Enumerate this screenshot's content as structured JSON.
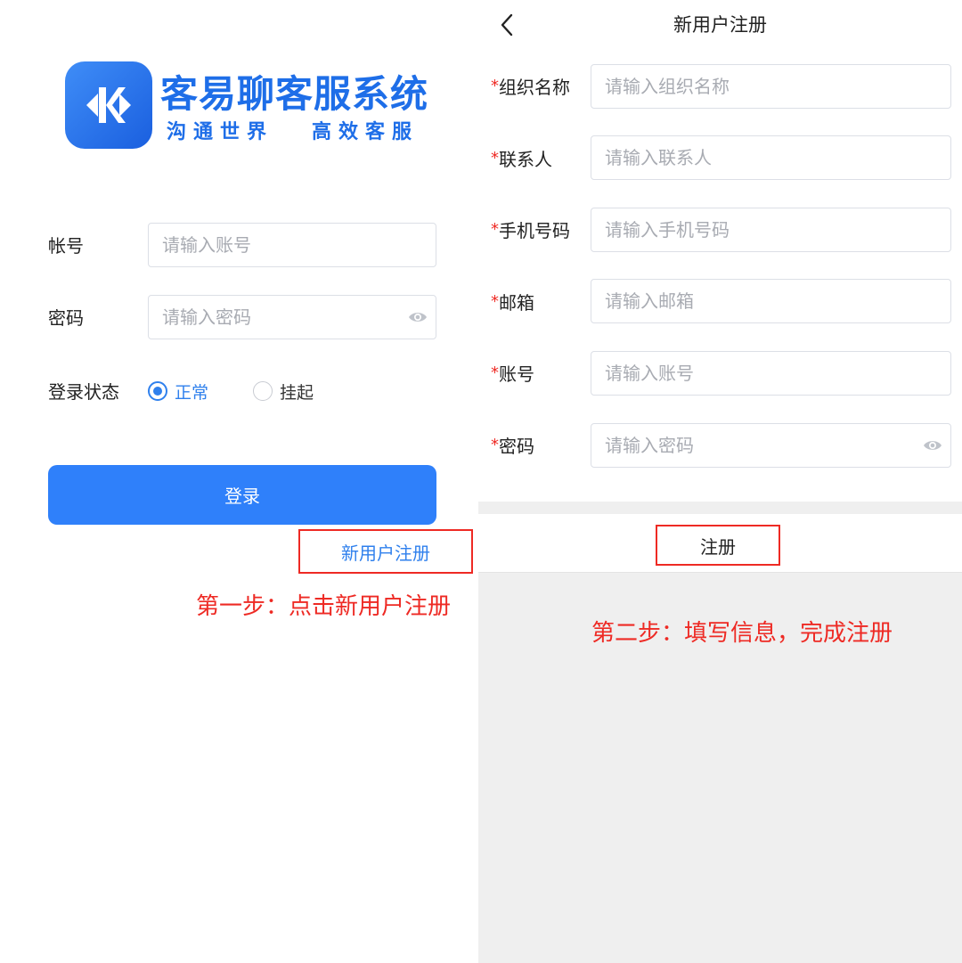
{
  "login": {
    "logo": {
      "title": "客易聊客服系统",
      "slogan_part1": "沟通世界",
      "slogan_part2": "高效客服",
      "brand_color": "#1e6ee8"
    },
    "account_label": "帐号",
    "account_placeholder": "请输入账号",
    "password_label": "密码",
    "password_placeholder": "请输入密码",
    "status_label": "登录状态",
    "status_options": [
      {
        "label": "正常",
        "checked": true
      },
      {
        "label": "挂起",
        "checked": false
      }
    ],
    "login_button": "登录",
    "register_link": "新用户注册",
    "annotation": "第一步：点击新用户注册",
    "accent_color": "#2f80fa",
    "annotation_color": "#ee2a24"
  },
  "register": {
    "title": "新用户注册",
    "back_icon": "chevron-left-icon",
    "fields": [
      {
        "star": "*",
        "label": "组织名称",
        "placeholder": "请输入组织名称"
      },
      {
        "star": "*",
        "label": "联系人",
        "placeholder": "请输入联系人"
      },
      {
        "star": "*",
        "label": "手机号码",
        "placeholder": "请输入手机号码"
      },
      {
        "star": "*",
        "label": "邮箱",
        "placeholder": "请输入邮箱"
      },
      {
        "star": "*",
        "label": "账号",
        "placeholder": "请输入账号"
      },
      {
        "star": "*",
        "label": "密码",
        "placeholder": "请输入密码"
      }
    ],
    "submit_button": "注册",
    "annotation": "第二步：填写信息，完成注册"
  }
}
